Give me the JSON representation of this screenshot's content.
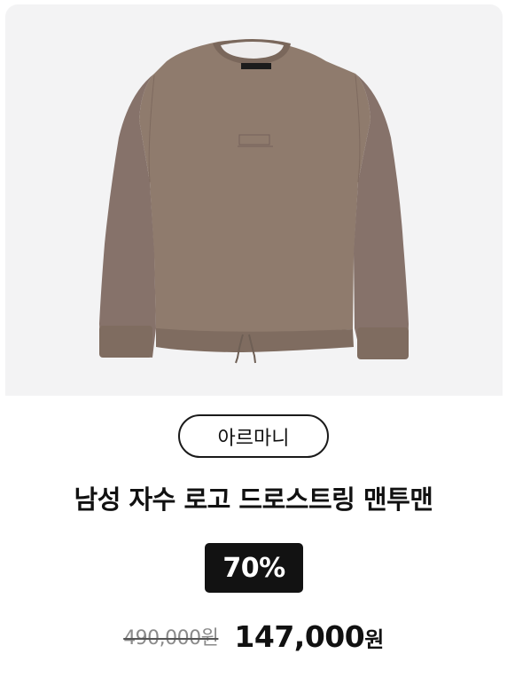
{
  "product": {
    "image_icon": "sweatshirt-image",
    "brand": "아르마니",
    "title": "남성 자수 로고 드로스트링 맨투맨",
    "discount": "70%",
    "original_price": "490,000원",
    "sale_price_number": "147,000",
    "sale_price_unit": "원"
  },
  "colors": {
    "image_background": "#f3f3f4",
    "garment": "#8f7b6d",
    "badge_background": "#121212",
    "text": "#111111",
    "original_price_text": "#8a8a8a"
  }
}
